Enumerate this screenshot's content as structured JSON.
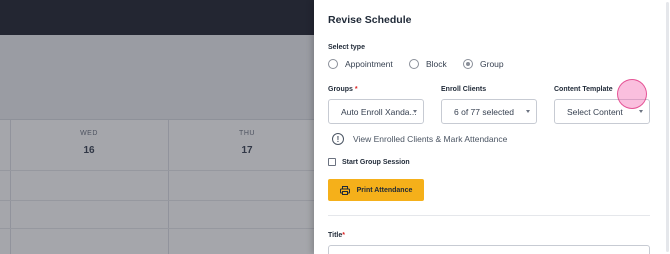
{
  "background": {
    "days": [
      {
        "name": "WED",
        "number": "16"
      },
      {
        "name": "THU",
        "number": "17"
      }
    ]
  },
  "drawer": {
    "title": "Revise Schedule",
    "select_type": {
      "label": "Select type",
      "options": [
        "Appointment",
        "Block",
        "Group"
      ],
      "selected": "Group"
    },
    "groups": {
      "label": "Groups",
      "required_mark": "*",
      "value": "Auto Enroll Xanda..."
    },
    "enroll_clients": {
      "label": "Enroll Clients",
      "value": "6 of 77 selected"
    },
    "content_template": {
      "label": "Content Template",
      "value": "Select Content"
    },
    "info_link": "View Enrolled Clients & Mark Attendance",
    "start_group_session": "Start Group Session",
    "print_button": "Print Attendance",
    "title_field": {
      "label": "Title",
      "required_mark": "*"
    }
  },
  "colors": {
    "accent_button": "#f5b01a",
    "required": "#dc2626"
  },
  "icons": [
    "info-icon",
    "printer-icon",
    "chevron-down-icon"
  ]
}
